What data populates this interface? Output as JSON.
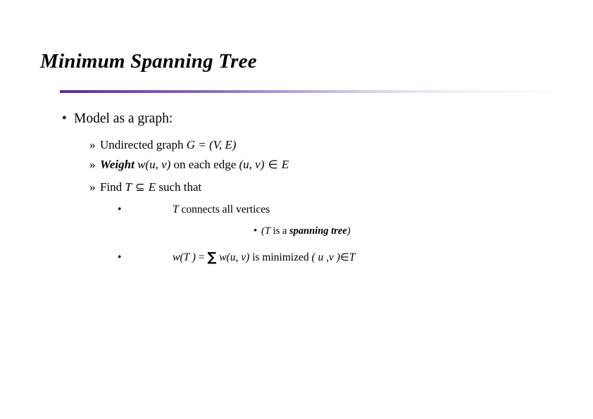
{
  "slide": {
    "title": "Minimum Spanning Tree",
    "accent_color": "#5b2d8e",
    "background_color": "#ffffff",
    "text_color": "#000000",
    "bullets": {
      "level1_glyph": "•",
      "level2_glyph": "»",
      "level3_glyph": "•",
      "level4_glyph": "•"
    },
    "content": {
      "model_as_a_graph": "Model as a graph:",
      "undirected": {
        "lead": "Undirected graph ",
        "math": "G = (V, E)"
      },
      "weight": {
        "term": "Weight",
        "func": " w(u, v)",
        "mid": " on each edge ",
        "edge": "(u, v)",
        "member": " ∈ ",
        "set": "E"
      },
      "find": {
        "lead": "Find ",
        "t": "T",
        "subset": " ⊆ ",
        "e": "E",
        "tail": " such that"
      },
      "connects": {
        "t": "T",
        "tail": " connects all vertices"
      },
      "spanning": {
        "open": "(",
        "t": "T",
        "mid": " is a ",
        "term": "spanning tree",
        "close": ")"
      },
      "minimized": {
        "lhs": "w(T )",
        "eq": " = ",
        "sigma": "∑",
        "fn": " w(u, v)",
        "tail": " is minimized ",
        "pair": "( u ,v )",
        "member": "∈",
        "t": "T"
      }
    }
  }
}
